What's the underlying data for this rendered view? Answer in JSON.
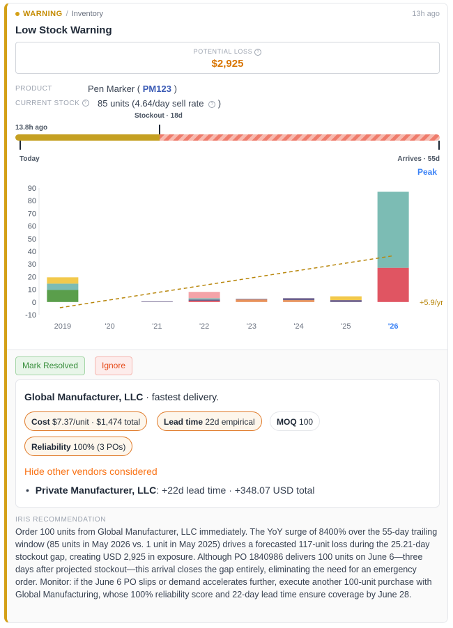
{
  "alert": {
    "severity": "WARNING",
    "category": "Inventory",
    "time_ago": "13h ago",
    "title": "Low Stock Warning",
    "accent_color": "#d4a017"
  },
  "potential_loss": {
    "label": "POTENTIAL LOSS",
    "value": "$2,925"
  },
  "product": {
    "label": "PRODUCT",
    "name_prefix": "Pen Marker (",
    "sku": "PM123",
    "name_suffix": ")"
  },
  "stock": {
    "label": "CURRENT STOCK",
    "value": "85 units (4.64/day sell rate",
    "suffix": ")"
  },
  "timeline": {
    "stockout_label": "Stockout · 18d",
    "updated_label": "13.8h ago",
    "start_label": "Today",
    "end_label": "Arrives · 55d",
    "peak_label": "Peak",
    "elapsed_fraction": 0.34
  },
  "chart_data": {
    "type": "bar",
    "categories": [
      "2019",
      "'20",
      "'21",
      "'22",
      "'23",
      "'24",
      "'25",
      "'26"
    ],
    "highlight_category": "'26",
    "ylim": [
      -10,
      90
    ],
    "yticks": [
      90,
      80,
      70,
      60,
      50,
      40,
      30,
      20,
      10,
      0,
      -10
    ],
    "series": [
      {
        "color": "#5a9e4b",
        "values": [
          9.5,
          0,
          0,
          0,
          0,
          0,
          0,
          0
        ]
      },
      {
        "color": "#e05562",
        "values": [
          0,
          0,
          0,
          1,
          0,
          0,
          0,
          27
        ]
      },
      {
        "color": "#e8915a",
        "values": [
          0,
          0,
          0,
          0,
          2,
          1.5,
          0,
          0
        ]
      },
      {
        "color": "#6c5f8a",
        "values": [
          0,
          0,
          0.5,
          1,
          0.5,
          1.5,
          1.5,
          0
        ]
      },
      {
        "color": "#7cbcb4",
        "values": [
          5,
          0,
          0,
          1,
          0,
          0,
          0,
          60
        ]
      },
      {
        "color": "#f4a3a8",
        "values": [
          0,
          0,
          0,
          5,
          0,
          0,
          0,
          0
        ]
      },
      {
        "color": "#f2c94c",
        "values": [
          5,
          0,
          0,
          0,
          0,
          0,
          3,
          0
        ]
      }
    ],
    "trend": {
      "start": -4.5,
      "end": 36.5,
      "color": "#b8860b",
      "label": "+5.9/yr"
    }
  },
  "actions": {
    "resolve": "Mark Resolved",
    "ignore": "Ignore"
  },
  "vendor": {
    "name": "Global Manufacturer, LLC",
    "tagline": "· fastest delivery.",
    "chips": {
      "cost_label": "Cost",
      "cost_value": "$7.37/unit · $1,474 total",
      "lead_label": "Lead time",
      "lead_value": "22d empirical",
      "moq_label": "MOQ",
      "moq_value": "100",
      "rel_label": "Reliability",
      "rel_value": "100% (3 POs)"
    },
    "toggle_label": "Hide other vendors considered",
    "others": [
      {
        "name": "Private Manufacturer, LLC",
        "detail": ": +22d lead time · +348.07 USD total"
      }
    ]
  },
  "recommendation": {
    "label": "IRIS RECOMMENDATION",
    "text": "Order 100 units from Global Manufacturer, LLC immediately. The YoY surge of 8400% over the 55-day trailing window (85 units in May 2026 vs. 1 unit in May 2025) drives a forecasted 117-unit loss during the 25.21-day stockout gap, creating USD 2,925 in exposure. Although PO 1840986 delivers 100 units on June 6—three days after projected stockout—this arrival closes the gap entirely, eliminating the need for an emergency order. Monitor: if the June 6 PO slips or demand accelerates further, execute another 100-unit purchase with Global Manufacturing, whose 100% reliability score and 22-day lead time ensure coverage by June 28."
  }
}
